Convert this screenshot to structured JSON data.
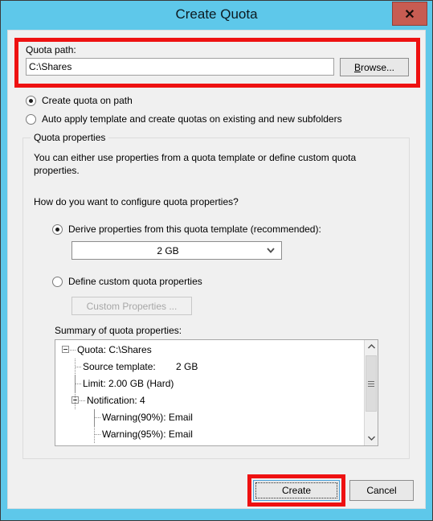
{
  "window": {
    "title": "Create Quota",
    "close_label": "✕"
  },
  "quota_path": {
    "label": "Quota path:",
    "value": "C:\\Shares",
    "placeholder": "",
    "browse_label": "Browse..."
  },
  "mode_options": [
    {
      "label": "Create quota on path",
      "selected": true
    },
    {
      "label": "Auto apply template and create quotas on existing and new subfolders",
      "selected": false
    }
  ],
  "quota_properties": {
    "group_title": "Quota properties",
    "description": "You can either use properties from a quota template or define custom quota properties.",
    "question": "How do you want to configure quota properties?",
    "derive_option": "Derive properties from this quota template (recommended):",
    "derive_selected": true,
    "template_value": "2 GB",
    "define_option": "Define custom quota properties",
    "define_selected": false,
    "custom_properties_label": "Custom Properties ...",
    "custom_properties_disabled": true
  },
  "summary": {
    "label": "Summary of quota properties:",
    "tree": [
      {
        "depth": 0,
        "toggle": "minus",
        "text": "Quota: C:\\Shares",
        "extra": ""
      },
      {
        "depth": 1,
        "toggle": "none",
        "text": "Source template:",
        "extra": "2 GB"
      },
      {
        "depth": 1,
        "toggle": "none",
        "text": "Limit: 2.00 GB (Hard)",
        "extra": ""
      },
      {
        "depth": 1,
        "toggle": "minus",
        "text": "Notification: 4",
        "extra": ""
      },
      {
        "depth": 2,
        "toggle": "none",
        "text": "Warning(90%): Email",
        "extra": ""
      },
      {
        "depth": 2,
        "toggle": "none",
        "text": "Warning(95%): Email",
        "extra": ""
      }
    ]
  },
  "footer": {
    "create_label": "Create",
    "cancel_label": "Cancel"
  },
  "colors": {
    "title_bar": "#5ec8ea",
    "close_button": "#c75c52",
    "annotation": "#ee1111",
    "focus_border": "#4a9fd8",
    "dialog_background": "#f0f0f0"
  }
}
